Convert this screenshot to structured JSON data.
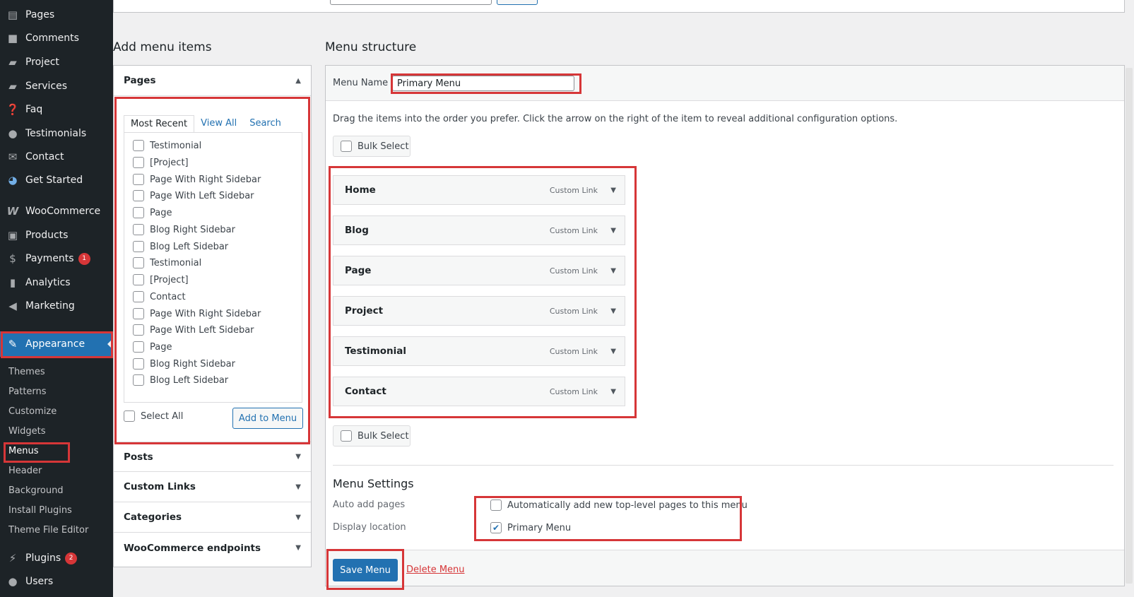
{
  "sidebar": {
    "items": [
      {
        "label": "Pages",
        "icon": "pages-icon"
      },
      {
        "label": "Comments",
        "icon": "comments-icon"
      },
      {
        "label": "Project",
        "icon": "folder-icon"
      },
      {
        "label": "Services",
        "icon": "folder-icon"
      },
      {
        "label": "Faq",
        "icon": "help-icon"
      },
      {
        "label": "Testimonials",
        "icon": "user-icon"
      },
      {
        "label": "Contact",
        "icon": "mail-icon"
      },
      {
        "label": "Get Started",
        "icon": "dashboard-icon"
      },
      {
        "label": "WooCommerce",
        "icon": "woocommerce-icon"
      },
      {
        "label": "Products",
        "icon": "archive-icon"
      },
      {
        "label": "Payments",
        "icon": "payments-icon",
        "badge": "1"
      },
      {
        "label": "Analytics",
        "icon": "chart-icon"
      },
      {
        "label": "Marketing",
        "icon": "megaphone-icon"
      },
      {
        "label": "Appearance",
        "icon": "brush-icon"
      },
      {
        "label": "Plugins",
        "icon": "plugin-icon",
        "badge": "2"
      },
      {
        "label": "Users",
        "icon": "users-icon"
      }
    ],
    "appearance_sub": [
      "Themes",
      "Patterns",
      "Customize",
      "Widgets",
      "Menus",
      "Header",
      "Background",
      "Install Plugins",
      "Theme File Editor"
    ]
  },
  "add_menu_items": {
    "title": "Add menu items",
    "pages": {
      "title": "Pages",
      "tabs": [
        "Most Recent",
        "View All",
        "Search"
      ],
      "items": [
        "Testimonial",
        "[Project]",
        "Page With Right Sidebar",
        "Page With Left Sidebar",
        "Page",
        "Blog Right Sidebar",
        "Blog Left Sidebar",
        "Testimonial",
        "[Project]",
        "Contact",
        "Page With Right Sidebar",
        "Page With Left Sidebar",
        "Page",
        "Blog Right Sidebar",
        "Blog Left Sidebar"
      ],
      "select_all": "Select All",
      "add_button": "Add to Menu"
    },
    "sections": [
      "Posts",
      "Custom Links",
      "Categories",
      "WooCommerce endpoints"
    ]
  },
  "menu_structure": {
    "title": "Menu structure",
    "name_label": "Menu Name",
    "name_value": "Primary Menu",
    "instructions": "Drag the items into the order you prefer. Click the arrow on the right of the item to reveal additional configuration options.",
    "bulk_select": "Bulk Select",
    "items": [
      {
        "title": "Home",
        "type": "Custom Link"
      },
      {
        "title": "Blog",
        "type": "Custom Link"
      },
      {
        "title": "Page",
        "type": "Custom Link"
      },
      {
        "title": "Project",
        "type": "Custom Link"
      },
      {
        "title": "Testimonial",
        "type": "Custom Link"
      },
      {
        "title": "Contact",
        "type": "Custom Link"
      }
    ],
    "settings": {
      "title": "Menu Settings",
      "auto_add_label": "Auto add pages",
      "auto_add_option": "Automatically add new top-level pages to this menu",
      "auto_add_checked": false,
      "display_label": "Display location",
      "display_option": "Primary Menu",
      "display_checked": true
    },
    "save_button": "Save Menu",
    "delete_link": "Delete Menu"
  },
  "colors": {
    "sidebar_bg": "#1d2327",
    "accent": "#2271b1",
    "highlight_box": "#d63638"
  }
}
